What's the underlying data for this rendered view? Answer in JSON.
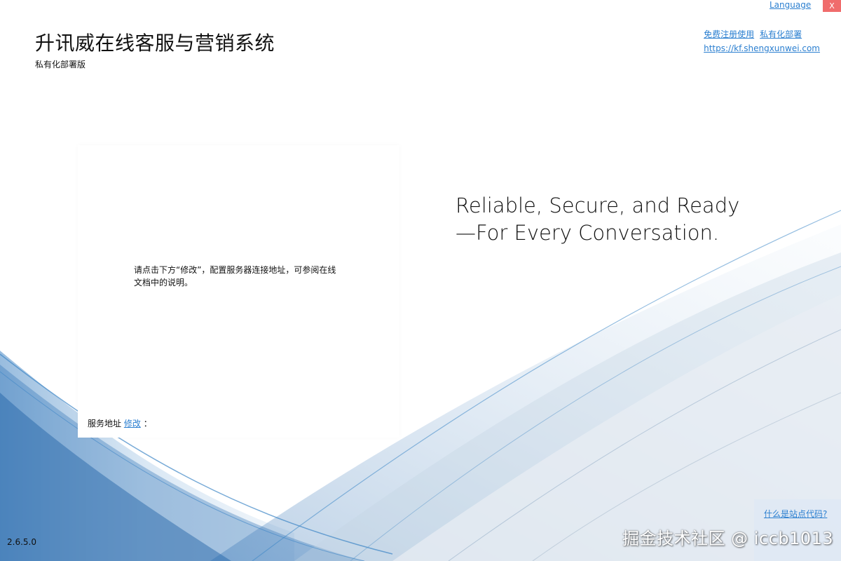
{
  "header": {
    "language_link": "Language",
    "close_label": "X",
    "app_title": "升讯威在线客服与营销系统",
    "app_subtitle": "私有化部署版",
    "free_register_link": "免费注册使用",
    "private_deploy_link": "私有化部署",
    "website_link": "https://kf.shengxunwei.com"
  },
  "panel": {
    "message": "请点击下方“修改”，配置服务器连接地址，可参阅在线文档中的说明。",
    "server_address_label": "服务地址",
    "modify_link": "修改",
    "colon": "："
  },
  "tagline": {
    "line1": "Reliable, Secure, and Ready",
    "line2": "—For Every Conversation."
  },
  "footer": {
    "version": "2.6.5.0",
    "site_code_link": "什么是站点代码?",
    "watermark": "掘金技术社区 @ iccb1013"
  },
  "colors": {
    "link": "#2b7fd0",
    "close_bg": "#f06c6c",
    "wave_blue": "#3d86c6"
  }
}
